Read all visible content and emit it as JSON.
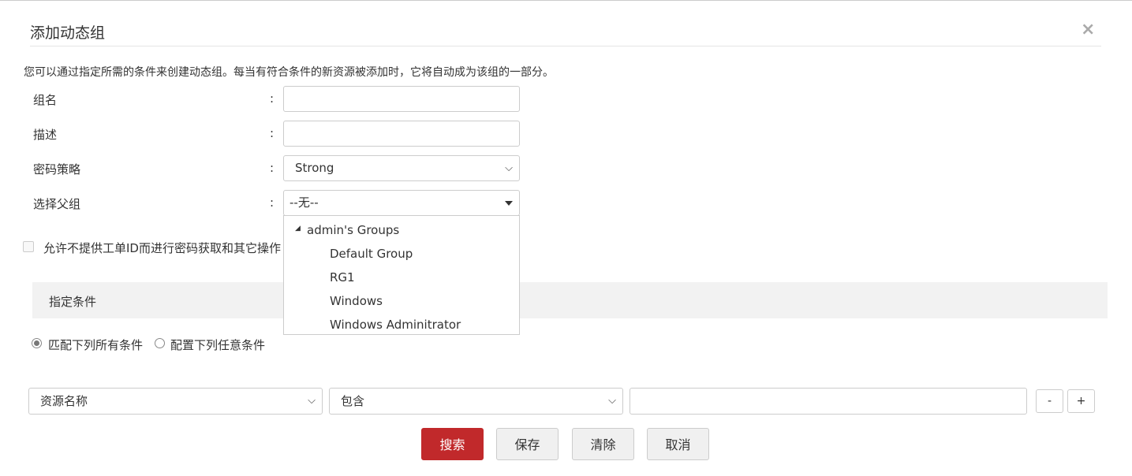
{
  "dialog": {
    "title": "添加动态组",
    "close_icon": "close-icon",
    "description": "您可以通过指定所需的条件来创建动态组。每当有符合条件的新资源被添加时，它将自动成为该组的一部分。"
  },
  "form": {
    "colon": ":",
    "group_name": {
      "label": "组名",
      "value": ""
    },
    "description": {
      "label": "描述",
      "value": ""
    },
    "password_policy": {
      "label": "密码策略",
      "value": "Strong"
    },
    "parent_group": {
      "label": "选择父组",
      "value": "--无--"
    },
    "allow_no_ticket": {
      "label": "允许不提供工单ID而进行密码获取和其它操作",
      "checked": false
    }
  },
  "parent_dropdown": {
    "root": "admin's Groups",
    "items": [
      "Default Group",
      "RG1",
      "Windows",
      "Windows Adminitrator"
    ]
  },
  "criteria": {
    "header": "指定条件",
    "match_all": "匹配下列所有条件",
    "match_any": "配置下列任意条件",
    "selected": "match_all",
    "field": "资源名称",
    "operator": "包含",
    "value": "",
    "remove": "-",
    "add": "+"
  },
  "buttons": {
    "search": "搜索",
    "save": "保存",
    "clear": "清除",
    "cancel": "取消"
  },
  "colors": {
    "primary": "#c1292b"
  }
}
